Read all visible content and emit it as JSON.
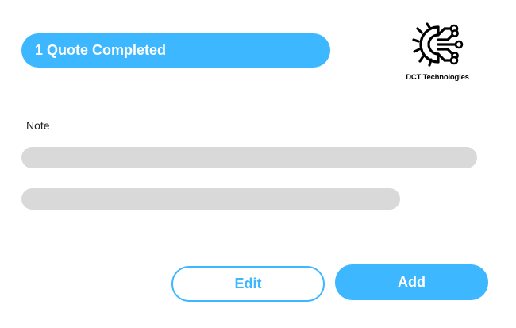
{
  "header": {
    "status_label": "1 Quote Completed",
    "brand": {
      "name": "DCT Technologies",
      "icon": "gear-circuit-icon"
    }
  },
  "note": {
    "label": "Note",
    "lines": [
      {
        "placeholder": ""
      },
      {
        "placeholder": ""
      }
    ]
  },
  "actions": {
    "edit_label": "Edit",
    "add_label": "Add"
  },
  "colors": {
    "accent": "#3db7ff",
    "placeholder_bar": "#d9d9d9",
    "divider": "#d9d9d9",
    "background": "#ffffff"
  }
}
